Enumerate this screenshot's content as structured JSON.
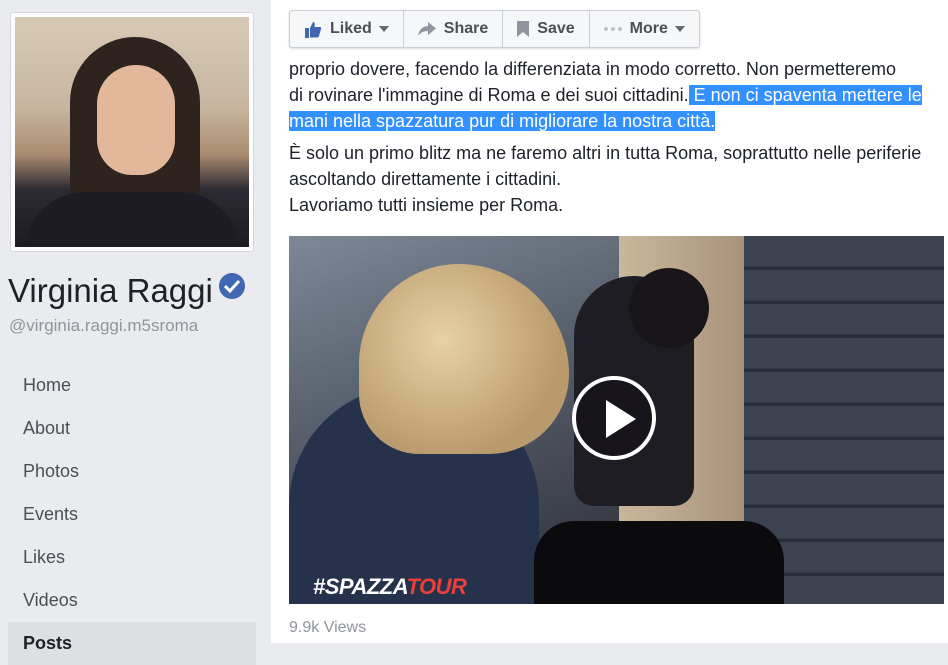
{
  "profile": {
    "name": "Virginia Raggi",
    "handle": "@virginia.raggi.m5sroma"
  },
  "nav": {
    "items": [
      "Home",
      "About",
      "Photos",
      "Events",
      "Likes",
      "Videos",
      "Posts"
    ]
  },
  "actions": {
    "liked": "Liked",
    "share": "Share",
    "save": "Save",
    "more": "More"
  },
  "post": {
    "line1": "proprio dovere, facendo la differenziata in modo corretto. Non permetteremo",
    "line2_plain": "di rovinare l'immagine di Roma e dei suoi cittadini.",
    "line2_highlight": " E non ci spaventa mettere le mani nella spazzatura pur di migliorare la nostra città.",
    "para2": "È solo un primo blitz ma ne faremo altri in tutta Roma, soprattutto nelle periferie ascoltando direttamente i cittadini.",
    "para3": "Lavoriamo tutti insieme per Roma."
  },
  "video": {
    "brand_hash": "#SPAZZA",
    "brand_word": "TOUR",
    "views": "9.9k Views"
  },
  "colors": {
    "accent": "#4267b2",
    "highlight": "#3390ff",
    "brand_red": "#e8403a"
  }
}
